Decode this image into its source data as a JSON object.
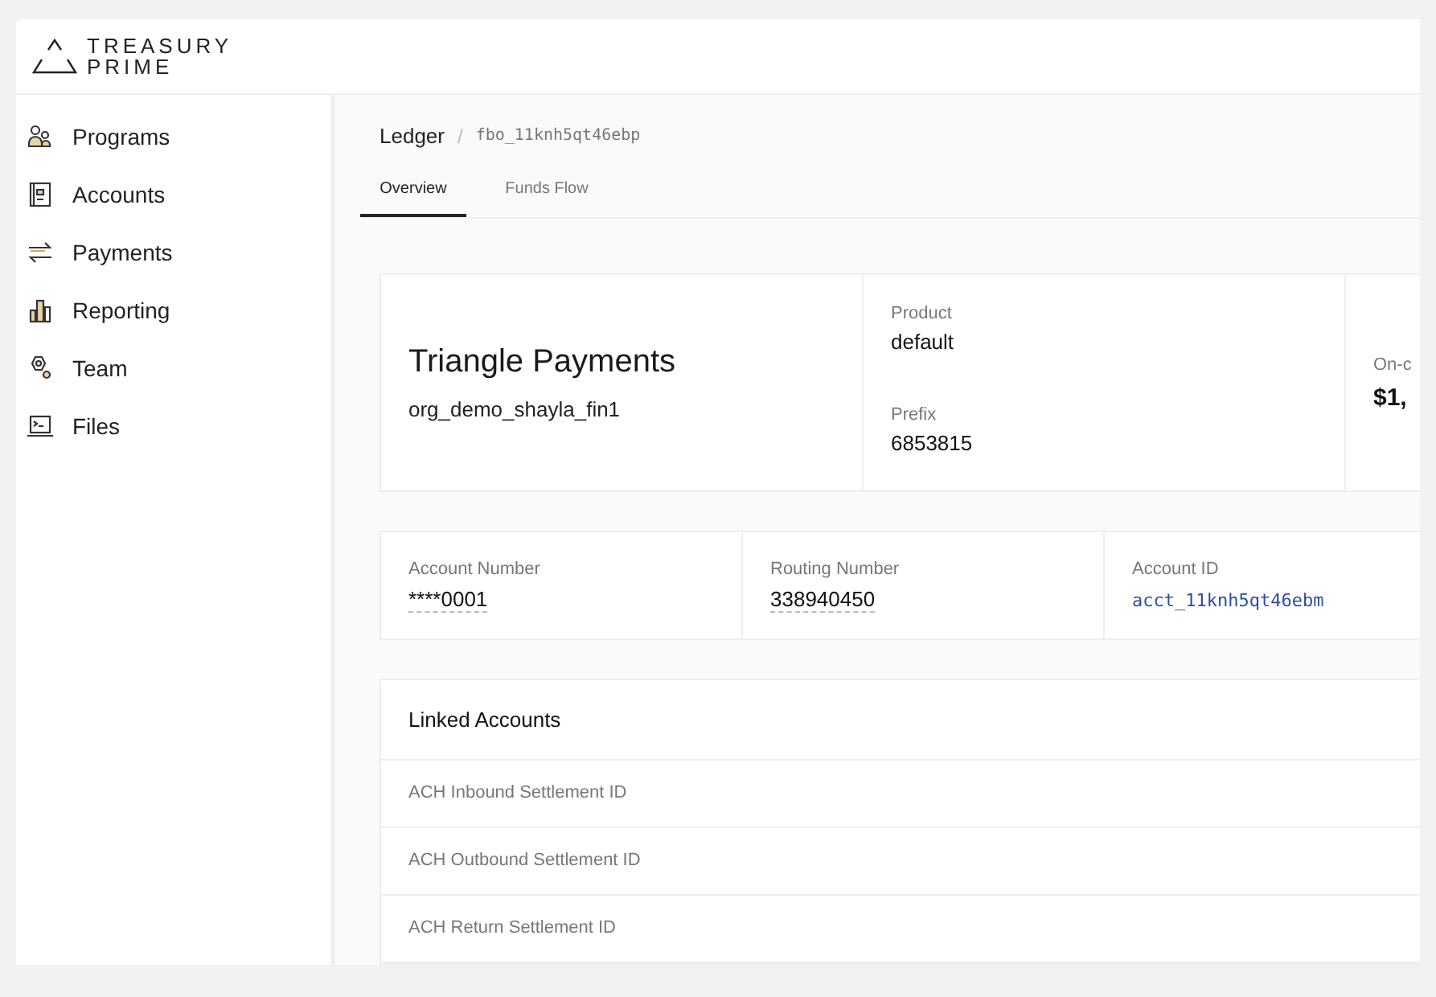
{
  "brand": {
    "line1": "TREASURY",
    "line2": "PRIME"
  },
  "sidebar": {
    "items": [
      {
        "label": "Programs",
        "kind": "programs"
      },
      {
        "label": "Accounts",
        "kind": "accounts"
      },
      {
        "label": "Payments",
        "kind": "payments"
      },
      {
        "label": "Reporting",
        "kind": "reporting"
      },
      {
        "label": "Team",
        "kind": "team"
      },
      {
        "label": "Files",
        "kind": "files"
      }
    ]
  },
  "breadcrumb": {
    "parent": "Ledger",
    "separator": "/",
    "current": "fbo_11knh5qt46ebp"
  },
  "tabs": [
    {
      "label": "Overview",
      "selected": true
    },
    {
      "label": "Funds Flow",
      "selected": false
    }
  ],
  "summary": {
    "name": "Triangle Payments",
    "org": "org_demo_shayla_fin1",
    "product_label": "Product",
    "product": "default",
    "prefix_label": "Prefix",
    "prefix": "6853815",
    "extra_label": "On-c",
    "extra_value": "$1,"
  },
  "numbers": [
    {
      "label": "Account Number",
      "value": "****0001",
      "kind": "masked"
    },
    {
      "label": "Routing Number",
      "value": "338940450",
      "kind": "masked"
    },
    {
      "label": "Account ID",
      "value": "acct_11knh5qt46ebm",
      "kind": "link"
    }
  ],
  "linked_accounts": {
    "title": "Linked Accounts",
    "rows": [
      "ACH Inbound Settlement ID",
      "ACH Outbound Settlement ID",
      "ACH Return Settlement ID"
    ]
  }
}
